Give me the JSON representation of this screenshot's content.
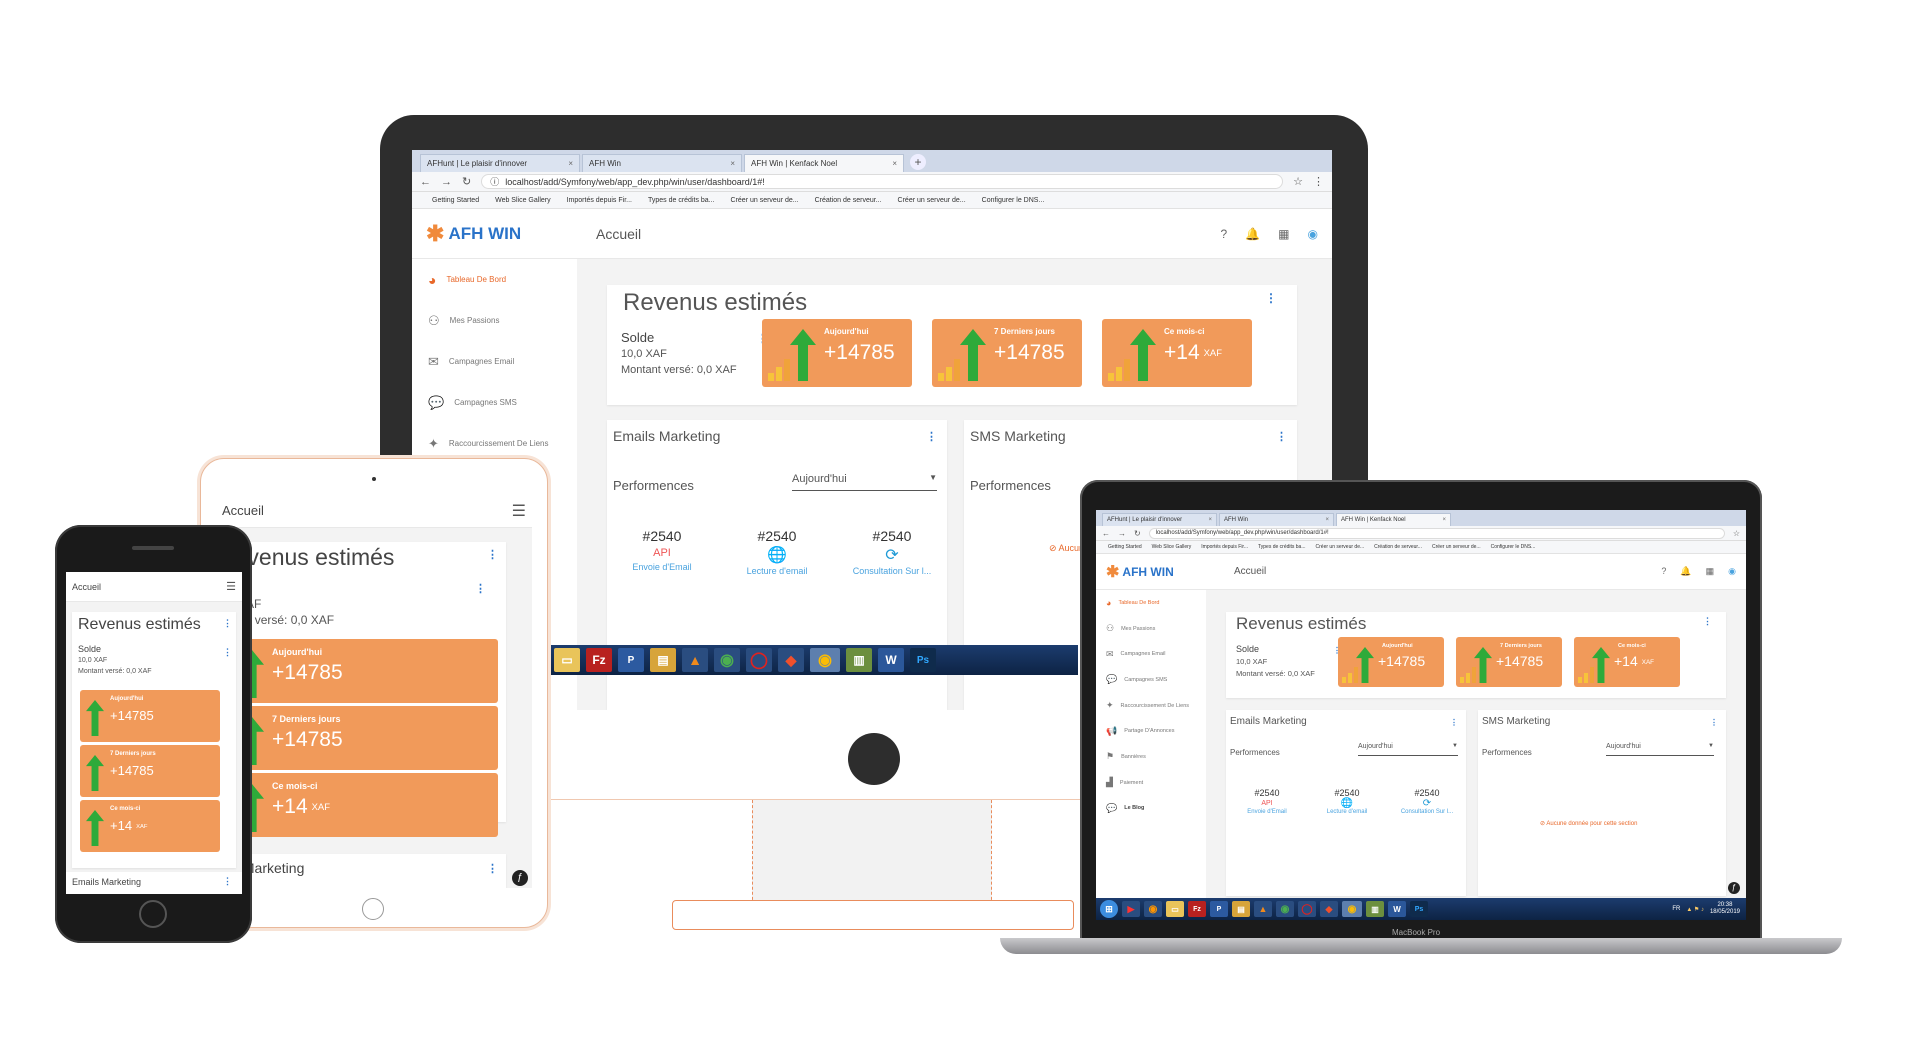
{
  "colors": {
    "accent": "#f19a5a",
    "brand_blue": "#2a73c9",
    "active_orange": "#e8682a",
    "link_blue": "#4aa3df",
    "error_orange": "#e8682a"
  },
  "browser": {
    "tabs": [
      "AFHunt | Le plaisir d'innover",
      "AFH Win",
      "AFH Win | Kenfack Noel"
    ],
    "url": "localhost/add/Symfony/web/app_dev.php/win/user/dashboard/1#!",
    "bookmarks": [
      "Getting Started",
      "Web Slice Gallery",
      "Importés depuis Fir...",
      "Types de crédits ba...",
      "Créer un serveur de...",
      "Création de serveur...",
      "Créer un serveur de...",
      "Configurer le DNS..."
    ]
  },
  "app": {
    "logo": "AFH WIN",
    "page_title": "Accueil",
    "sidebar": [
      "Tableau De Bord",
      "Mes Passions",
      "Campagnes Email",
      "Campagnes SMS",
      "Raccourcissement De Liens",
      "Partage D'Annonces",
      "Bannières",
      "Paiement",
      "Le Blog"
    ],
    "revenus": {
      "title": "Revenus estimés",
      "solde_label": "Solde",
      "solde_value": "10,0 XAF",
      "montant": "Montant versé: 0,0 XAF",
      "stats": [
        {
          "label": "Aujourd'hui",
          "value": "+14785",
          "unit": ""
        },
        {
          "label": "7 Derniers jours",
          "value": "+14785",
          "unit": ""
        },
        {
          "label": "Ce mois-ci",
          "value": "+14",
          "unit": "XAF"
        }
      ]
    },
    "emails": {
      "title": "Emails Marketing",
      "perf": "Performences",
      "select": "Aujourd'hui",
      "metrics": [
        {
          "num": "#2540",
          "cap": "Envoie d'Email",
          "icon": "api-icon"
        },
        {
          "num": "#2540",
          "cap": "Lecture d'email",
          "icon": "globe-icon"
        },
        {
          "num": "#2540",
          "cap": "Consultation Sur l...",
          "icon": "refresh-icon"
        }
      ]
    },
    "sms": {
      "title": "SMS Marketing",
      "perf": "Performences",
      "select": "Aujourd'hui",
      "empty": "Aucune donnée pour cette section"
    }
  },
  "tablet": {
    "title": "Accueil",
    "revenus": "Revenus estimés",
    "solde_label": "olde",
    "solde_value": "0,0 XAF",
    "montant": "ontant versé: 0,0 XAF",
    "emails": "ails Marketing"
  },
  "laptop_brand": "MacBook Pro",
  "taskbar": {
    "lang": "FR",
    "time": "20:38",
    "date": "18/05/2019"
  }
}
